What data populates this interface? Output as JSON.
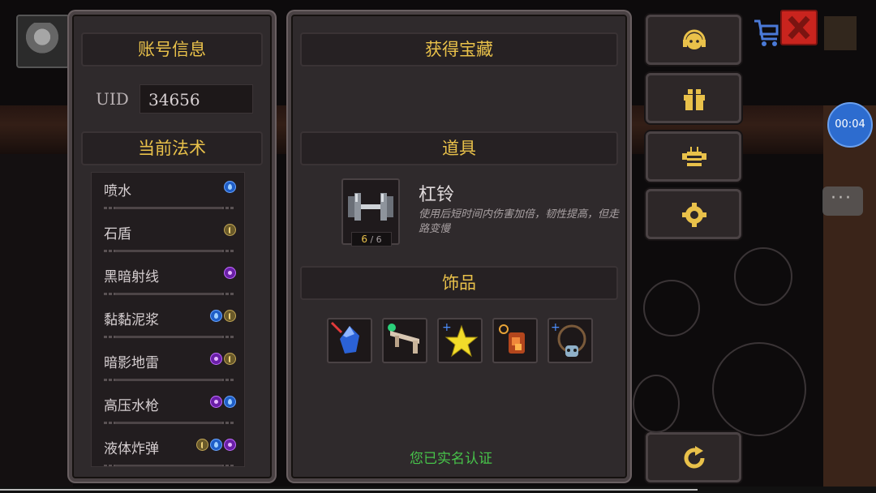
{
  "account": {
    "header": "账号信息",
    "uid_label": "UID",
    "uid_value": "34656"
  },
  "spells": {
    "header": "当前法术",
    "items": [
      {
        "name": "喷水",
        "elements": [
          "water"
        ]
      },
      {
        "name": "石盾",
        "elements": [
          "earth"
        ]
      },
      {
        "name": "黑暗射线",
        "elements": [
          "dark"
        ]
      },
      {
        "name": "黏黏泥浆",
        "elements": [
          "water",
          "earth"
        ]
      },
      {
        "name": "暗影地雷",
        "elements": [
          "dark",
          "earth"
        ]
      },
      {
        "name": "高压水枪",
        "elements": [
          "dark",
          "water"
        ]
      },
      {
        "name": "液体炸弹",
        "elements": [
          "earth",
          "water",
          "dark"
        ]
      }
    ]
  },
  "treasure": {
    "header": "获得宝藏",
    "items_header": "道具",
    "item": {
      "name": "杠铃",
      "description": "使用后短时间内伤害加倍，韧性提高，但走路变慢",
      "count_current": "6",
      "count_sep": "/",
      "count_max": "6",
      "icon": "barbell-icon"
    },
    "accessories_header": "饰品",
    "accessories": [
      {
        "icon": "blue-gem-icon"
      },
      {
        "icon": "bone-wand-icon"
      },
      {
        "icon": "star-icon"
      },
      {
        "icon": "orange-charm-icon"
      },
      {
        "icon": "skull-necklace-icon"
      }
    ],
    "verified_text": "您已实名认证"
  },
  "sidebar": {
    "buttons": [
      {
        "name": "customer-service-button",
        "icon": "headset-icon"
      },
      {
        "name": "gift-button",
        "icon": "gift-icon"
      },
      {
        "name": "bee-button",
        "icon": "bee-icon"
      },
      {
        "name": "settings-button",
        "icon": "gear-icon"
      },
      {
        "name": "restart-button",
        "icon": "restart-icon"
      }
    ]
  },
  "overlay": {
    "timer": "00:04"
  },
  "colors": {
    "accent_gold": "#e9c14a",
    "verified_green": "#47c24a",
    "close_red": "#c9241e",
    "timer_blue": "#2d6ccf"
  }
}
